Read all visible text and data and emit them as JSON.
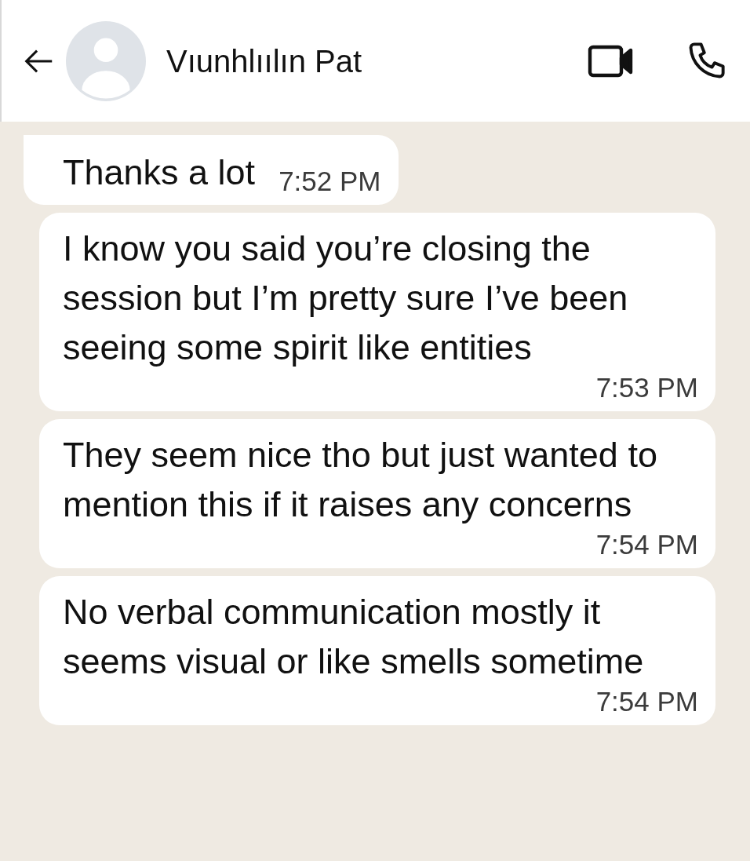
{
  "header": {
    "contact_name": "Vıunhlıılın Pat"
  },
  "messages": [
    {
      "text": "Thanks a lot",
      "time": "7:52 PM",
      "first": true
    },
    {
      "text": "I know you said you’re closing the session but I’m pretty sure I’ve been seeing some spirit like entities",
      "time": "7:53 PM",
      "first": false
    },
    {
      "text": "They seem nice tho but just wanted to mention this if it raises any concerns",
      "time": "7:54 PM",
      "first": false
    },
    {
      "text": "No verbal communication mostly it seems visual or like smells sometime",
      "time": "7:54 PM",
      "first": false
    }
  ]
}
